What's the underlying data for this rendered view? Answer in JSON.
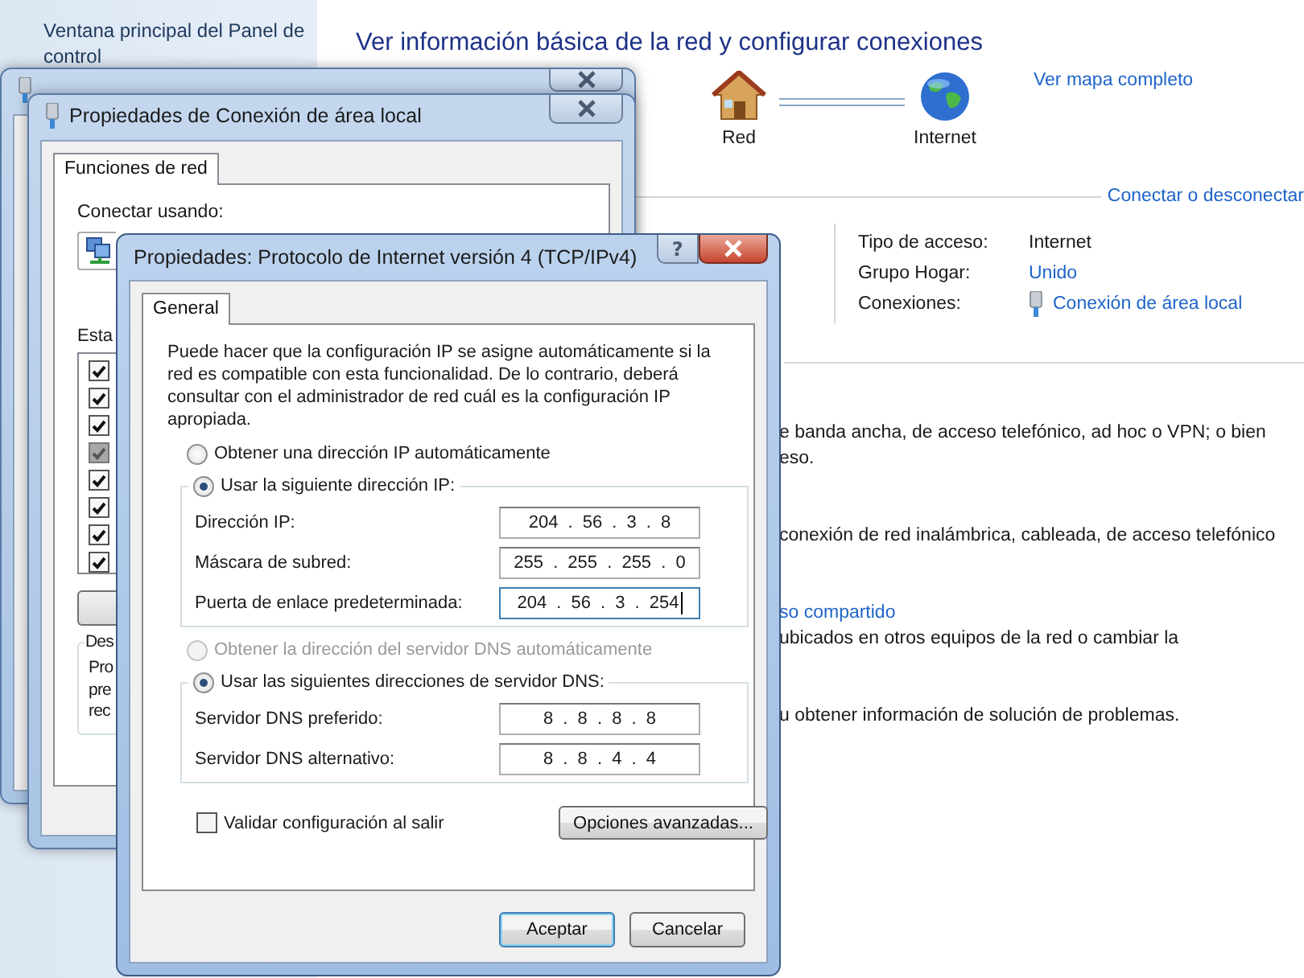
{
  "control_panel": {
    "sidebar_link": "Ventana principal del Panel de control",
    "heading": "Ver información básica de la red y configurar conexiones",
    "map_nodes": [
      {
        "label": "Red",
        "kind": "house"
      },
      {
        "label": "Internet",
        "kind": "globe"
      }
    ],
    "map_link": "Ver mapa completo",
    "connect_link": "Conectar o desconectar",
    "details": [
      {
        "label": "Tipo de acceso:",
        "value": "Internet",
        "kind": "text"
      },
      {
        "label": "Grupo Hogar:",
        "value": "Unido",
        "kind": "link"
      },
      {
        "label": "Conexiones:",
        "value": "Conexión de área local",
        "kind": "connection"
      }
    ],
    "task_sections": [
      {
        "lines": [
          {
            "text": "e banda ancha, de acceso telefónico, ad hoc o VPN; o bien",
            "kind": "text"
          },
          {
            "text": "eso.",
            "kind": "text"
          }
        ]
      },
      {
        "lines": [
          {
            "text": "conexión de red inalámbrica, cableada, de acceso telefónico",
            "kind": "text"
          }
        ]
      },
      {
        "lines": [
          {
            "text": "so compartido",
            "kind": "link"
          },
          {
            "text": "ubicados en otros equipos de la red o cambiar la",
            "kind": "text"
          }
        ]
      },
      {
        "lines": [
          {
            "text": "u obtener información de solución de problemas.",
            "kind": "text"
          }
        ]
      }
    ]
  },
  "properties_window": {
    "title": "Propiedades de Conexión de área local",
    "tabs": [
      {
        "label": "Funciones de red",
        "selected": true
      }
    ],
    "connect_label": "Conectar usando:",
    "items_label": "Esta",
    "items": [
      {
        "checked": true,
        "disabled": false
      },
      {
        "checked": true,
        "disabled": false
      },
      {
        "checked": true,
        "disabled": false
      },
      {
        "checked": true,
        "disabled": true
      },
      {
        "checked": true,
        "disabled": false
      },
      {
        "checked": true,
        "disabled": false
      },
      {
        "checked": true,
        "disabled": false
      },
      {
        "checked": true,
        "disabled": false
      }
    ],
    "description_title": "Des",
    "description_lines": [
      "Pro",
      "pre",
      "rec"
    ]
  },
  "ipv4_dialog": {
    "title": "Propiedades: Protocolo de Internet versión 4 (TCP/IPv4)",
    "help_button": "?",
    "tabs": [
      {
        "label": "General",
        "selected": true
      }
    ],
    "intro": "Puede hacer que la configuración IP se asigne automáticamente si la red es compatible con esta funcionalidad. De lo contrario, deberá consultar con el administrador de red cuál es la configuración IP apropiada.",
    "ip_options": [
      {
        "label": "Obtener una dirección IP automáticamente",
        "selected": false,
        "disabled": false
      },
      {
        "label": "Usar la siguiente dirección IP:",
        "selected": true,
        "disabled": false
      }
    ],
    "ip_fields": [
      {
        "label": "Dirección IP:",
        "value": "204 . 56 . 3 . 8",
        "focused": false
      },
      {
        "label": "Máscara de subred:",
        "value": "255 . 255 . 255 . 0",
        "focused": false
      },
      {
        "label": "Puerta de enlace predeterminada:",
        "value": "204 . 56 . 3 . 254",
        "focused": true
      }
    ],
    "dns_options": [
      {
        "label": "Obtener la dirección del servidor DNS automáticamente",
        "selected": false,
        "disabled": true
      },
      {
        "label": "Usar las siguientes direcciones de servidor DNS:",
        "selected": true,
        "disabled": false
      }
    ],
    "dns_fields": [
      {
        "label": "Servidor DNS preferido:",
        "value": "8 . 8 . 8 . 8",
        "focused": false
      },
      {
        "label": "Servidor DNS alternativo:",
        "value": "8 . 8 . 4 . 4",
        "focused": false
      }
    ],
    "validate": {
      "label": "Validar configuración al salir",
      "checked": false
    },
    "advanced_button": "Opciones avanzadas...",
    "buttons": [
      {
        "label": "Aceptar",
        "default": true
      },
      {
        "label": "Cancelar",
        "default": false
      }
    ]
  }
}
